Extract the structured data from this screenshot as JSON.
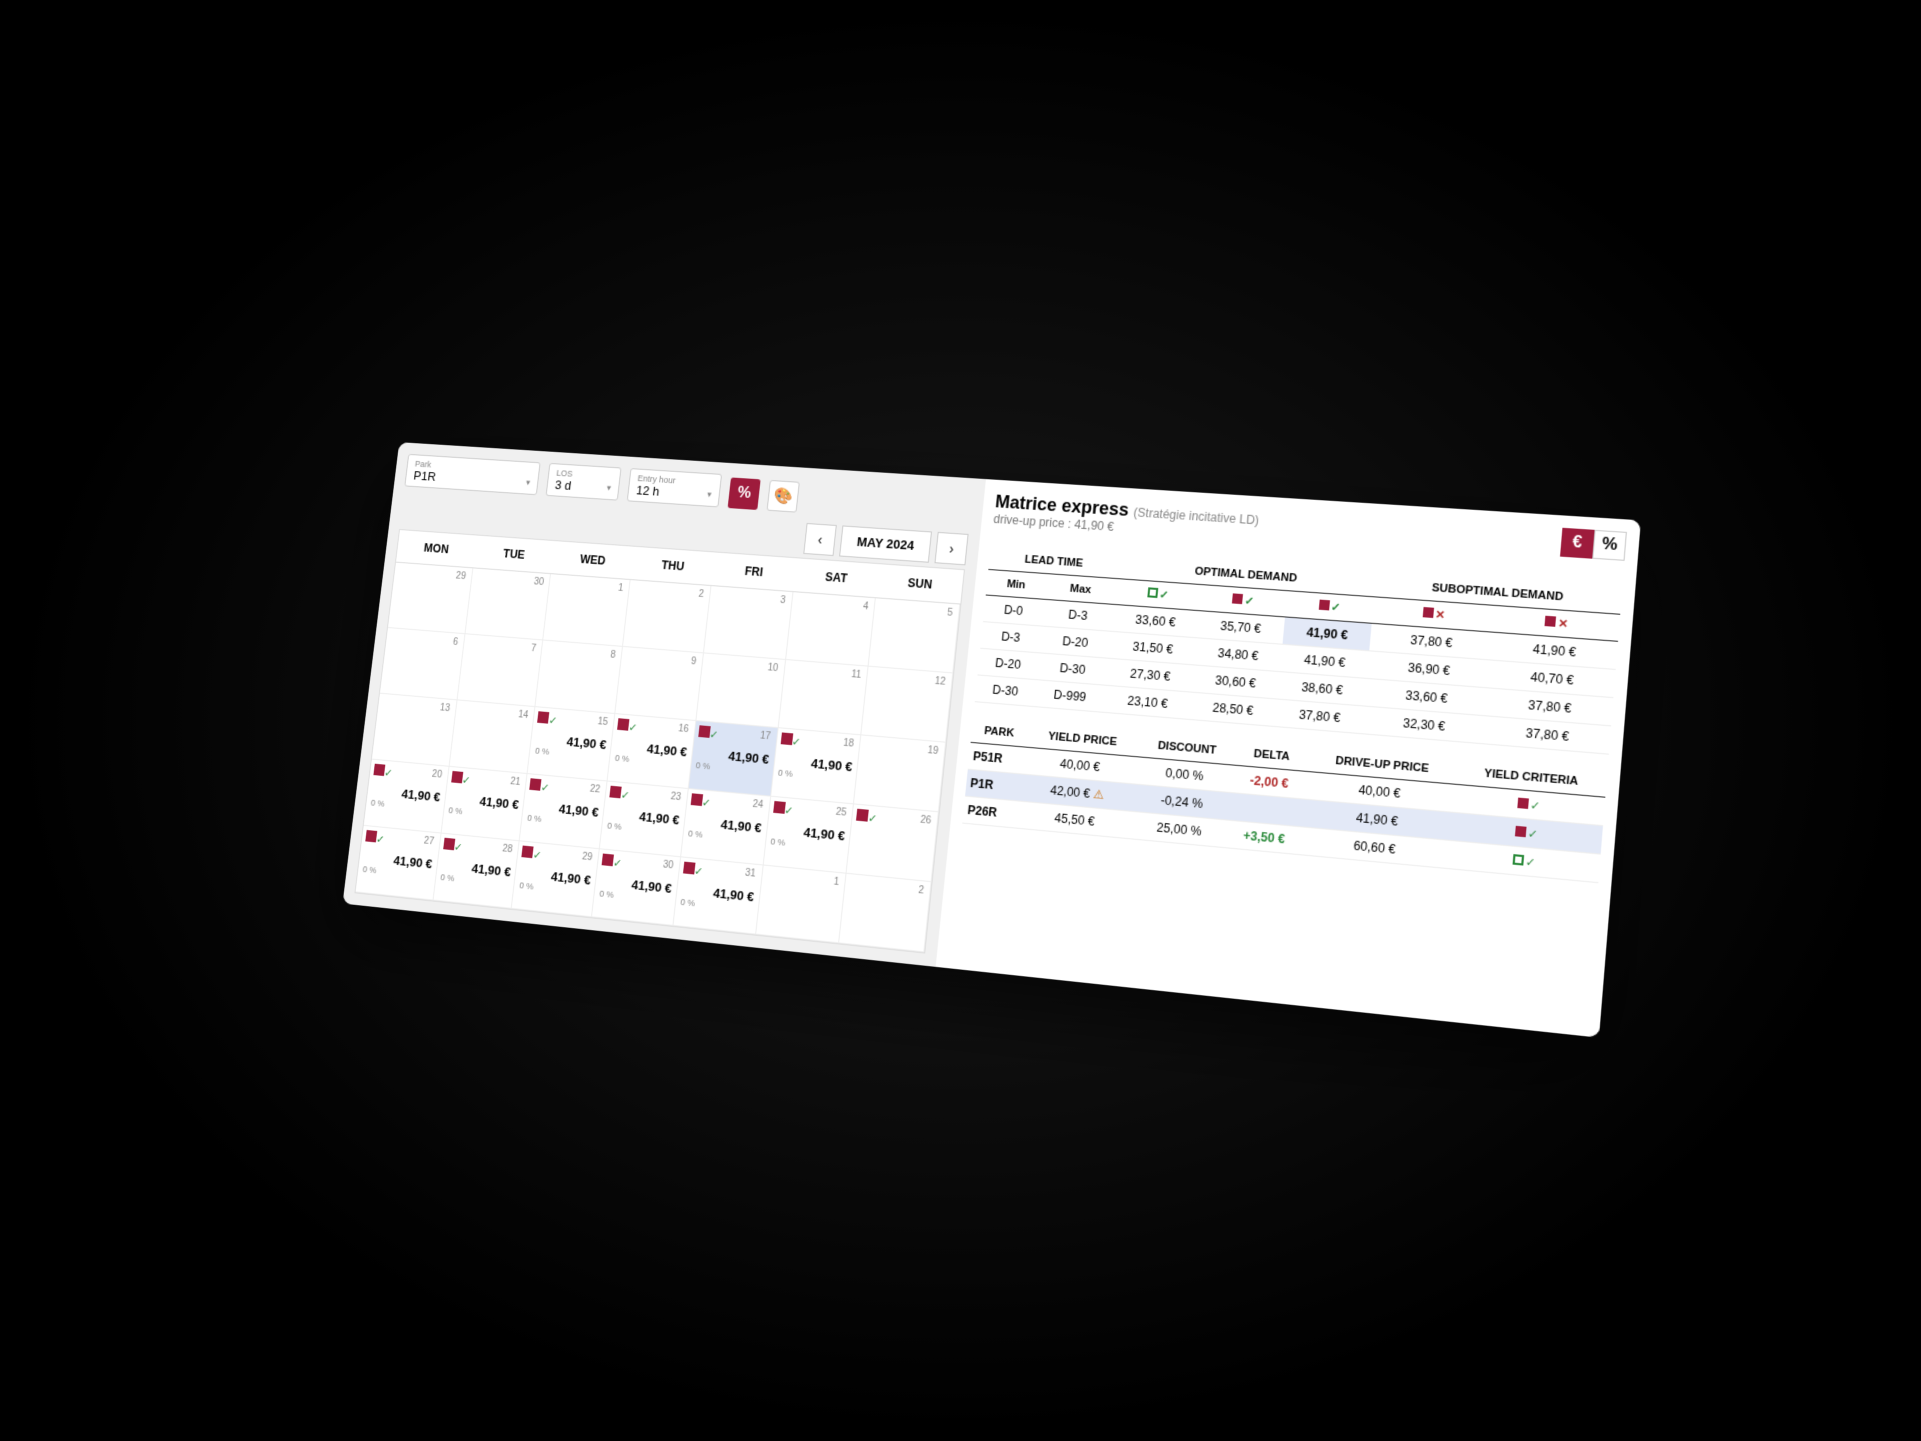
{
  "filters": {
    "park": {
      "label": "Park",
      "value": "P1R"
    },
    "los": {
      "label": "LOS",
      "value": "3 d"
    },
    "entry": {
      "label": "Entry hour",
      "value": "12 h"
    }
  },
  "month": "MAY 2024",
  "weekdays": [
    "MON",
    "TUE",
    "WED",
    "THU",
    "FRI",
    "SAT",
    "SUN"
  ],
  "cells": [
    {
      "day": "29",
      "dim": true
    },
    {
      "day": "30",
      "dim": true
    },
    {
      "day": "1"
    },
    {
      "day": "2"
    },
    {
      "day": "3"
    },
    {
      "day": "4"
    },
    {
      "day": "5"
    },
    {
      "day": "6"
    },
    {
      "day": "7"
    },
    {
      "day": "8"
    },
    {
      "day": "9"
    },
    {
      "day": "10"
    },
    {
      "day": "11"
    },
    {
      "day": "12"
    },
    {
      "day": "13"
    },
    {
      "day": "14"
    },
    {
      "day": "15",
      "price": "41,90 €",
      "pct": "0 %",
      "icon": true
    },
    {
      "day": "16",
      "price": "41,90 €",
      "pct": "0 %",
      "icon": true
    },
    {
      "day": "17",
      "price": "41,90 €",
      "pct": "0 %",
      "icon": true,
      "today": true
    },
    {
      "day": "18",
      "price": "41,90 €",
      "pct": "0 %",
      "icon": true
    },
    {
      "day": "19"
    },
    {
      "day": "20",
      "price": "41,90 €",
      "pct": "0 %",
      "icon": true
    },
    {
      "day": "21",
      "price": "41,90 €",
      "pct": "0 %",
      "icon": true
    },
    {
      "day": "22",
      "price": "41,90 €",
      "pct": "0 %",
      "icon": true
    },
    {
      "day": "23",
      "price": "41,90 €",
      "pct": "0 %",
      "icon": true
    },
    {
      "day": "24",
      "price": "41,90 €",
      "pct": "0 %",
      "icon": true
    },
    {
      "day": "25",
      "price": "41,90 €",
      "pct": "0 %",
      "icon": true
    },
    {
      "day": "26",
      "icon": true
    },
    {
      "day": "27",
      "price": "41,90 €",
      "pct": "0 %",
      "icon": true
    },
    {
      "day": "28",
      "price": "41,90 €",
      "pct": "0 %",
      "icon": true
    },
    {
      "day": "29",
      "price": "41,90 €",
      "pct": "0 %",
      "icon": true
    },
    {
      "day": "30",
      "price": "41,90 €",
      "pct": "0 %",
      "icon": true
    },
    {
      "day": "31",
      "price": "41,90 €",
      "pct": "0 %",
      "icon": true
    },
    {
      "day": "1",
      "dim": true
    },
    {
      "day": "2",
      "dim": true
    }
  ],
  "matrix": {
    "title": "Matrice express",
    "subtitle": "(Stratégie incitative LD)",
    "driveup": "drive-up price : 41,90 €",
    "headers": {
      "lead": "LEAD TIME",
      "min": "Min",
      "max": "Max",
      "opt": "OPTIMAL DEMAND",
      "sub": "SUBOPTIMAL DEMAND"
    },
    "rows": [
      {
        "min": "D-0",
        "max": "D-3",
        "a": "33,60 €",
        "b": "35,70 €",
        "c": "41,90 €",
        "d": "37,80 €",
        "e": "41,90 €",
        "sel": "c"
      },
      {
        "min": "D-3",
        "max": "D-20",
        "a": "31,50 €",
        "b": "34,80 €",
        "c": "41,90 €",
        "d": "36,90 €",
        "e": "40,70 €"
      },
      {
        "min": "D-20",
        "max": "D-30",
        "a": "27,30 €",
        "b": "30,60 €",
        "c": "38,60 €",
        "d": "33,60 €",
        "e": "37,80 €"
      },
      {
        "min": "D-30",
        "max": "D-999",
        "a": "23,10 €",
        "b": "28,50 €",
        "c": "37,80 €",
        "d": "32,30 €",
        "e": "37,80 €"
      }
    ]
  },
  "park_table": {
    "headers": {
      "park": "PARK",
      "yp": "YIELD PRICE",
      "disc": "DISCOUNT",
      "delta": "DELTA",
      "dup": "DRIVE-UP PRICE",
      "yc": "YIELD CRITERIA"
    },
    "rows": [
      {
        "park": "P51R",
        "yp": "40,00 €",
        "disc": "0,00 %",
        "delta": "-2,00 €",
        "dup": "40,00 €",
        "neg": true,
        "crit": "g"
      },
      {
        "park": "P1R",
        "yp": "42,00 €",
        "warn": true,
        "disc": "-0,24 %",
        "delta": "",
        "dup": "41,90 €",
        "hl": true,
        "crit": "g"
      },
      {
        "park": "P26R",
        "yp": "45,50 €",
        "disc": "25,00 %",
        "delta": "+3,50 €",
        "dup": "60,60 €",
        "pos": true,
        "crit": "b"
      }
    ]
  }
}
